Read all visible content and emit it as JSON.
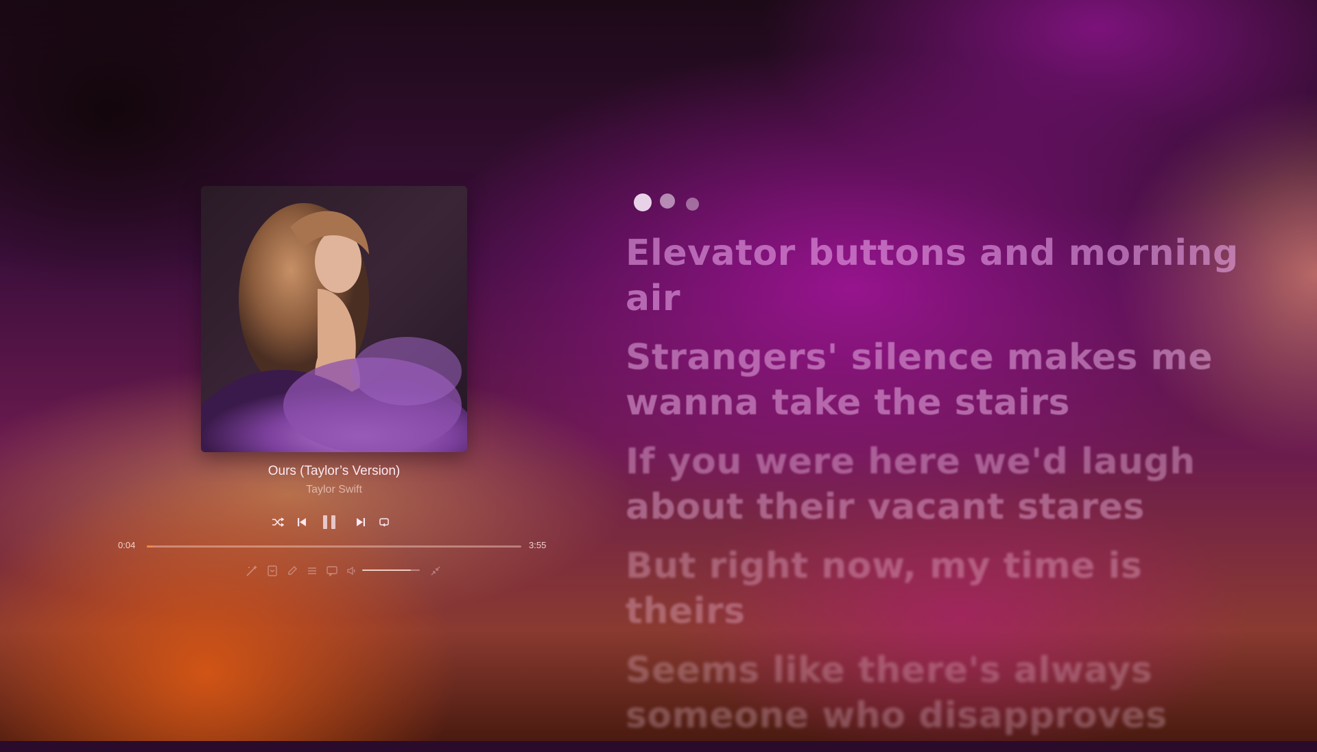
{
  "colors": {
    "accent_progress": "#f08a4a",
    "text_primary": "#fbe9f3",
    "lyric_tint": "#f0aff0"
  },
  "now_playing": {
    "title": "Ours (Taylor’s Version)",
    "artist": "Taylor Swift",
    "cover_alt": "album cover - woman with curly hair in purple tulle dress"
  },
  "playback": {
    "current_time": "0:04",
    "duration": "3:55",
    "progress_fraction": 0.017,
    "volume_fraction": 0.85,
    "state": "playing"
  },
  "controls": {
    "shuffle_icon": "shuffle-icon",
    "previous_icon": "skip-previous-icon",
    "pause_icon": "pause-icon",
    "next_icon": "skip-next-icon",
    "repeat_icon": "repeat-icon"
  },
  "tools": {
    "items": [
      "magic-wand-icon",
      "queue-box-icon",
      "edit-icon",
      "list-icon",
      "lyrics-icon",
      "volume-icon",
      "minimize-icon"
    ]
  },
  "lyrics": {
    "loading_indicator": "three-dots",
    "lines": [
      "Elevator buttons and morning air",
      "Strangers' silence makes me wanna take the stairs",
      "If you were here we'd laugh about their vacant stares",
      "But right now, my time is theirs",
      "Seems like there's always someone who disapproves"
    ]
  }
}
